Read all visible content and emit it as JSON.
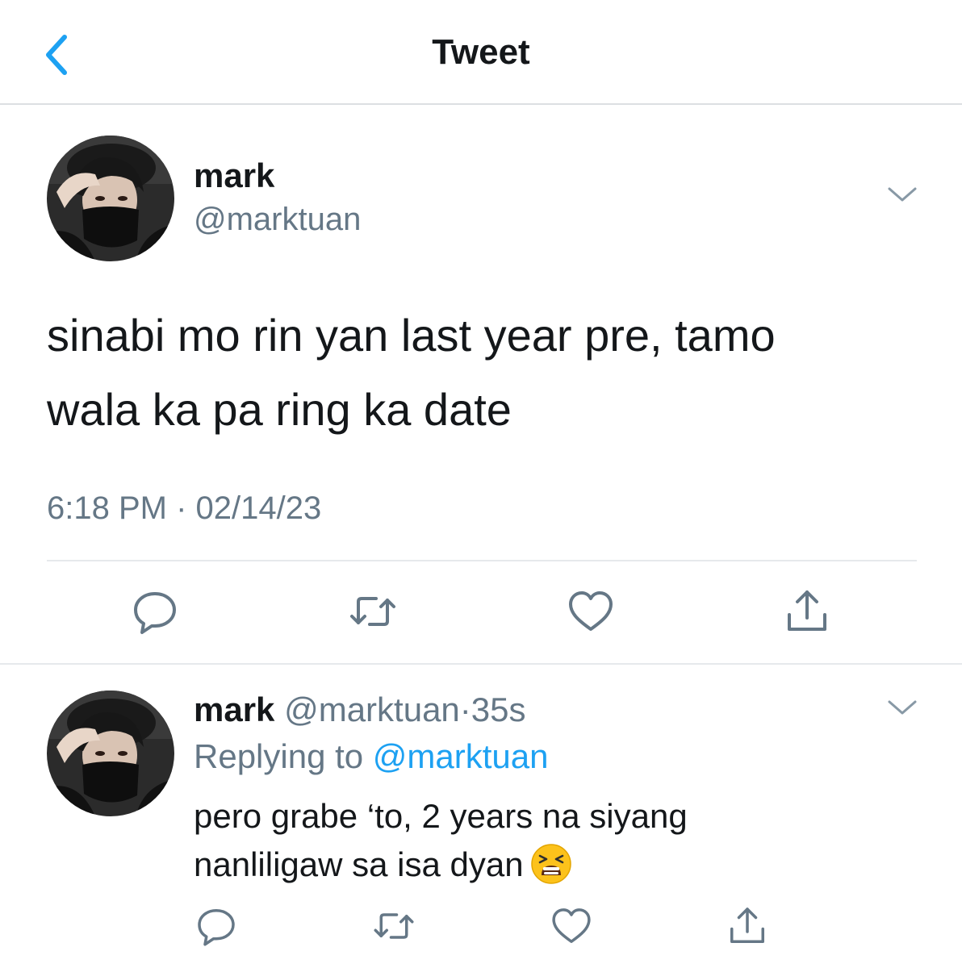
{
  "header": {
    "title": "Tweet",
    "back_icon": "chevron-left-icon",
    "accent": "#1da1f2"
  },
  "tweet": {
    "name": "mark",
    "handle": "@marktuan",
    "text_line1": "sinabi mo rin yan last year pre, tamo",
    "text_line2": "wala ka pa ring ka date",
    "timestamp": "6:18 PM · 02/14/23",
    "actions": [
      "reply-icon",
      "retweet-icon",
      "like-icon",
      "share-icon"
    ]
  },
  "reply": {
    "name": "mark",
    "handle": "@marktuan",
    "dot": "·",
    "time": "35s",
    "replying_prefix": "Replying to ",
    "replying_to": "@marktuan",
    "text_line1": "pero grabe ‘to, 2 years na siyang",
    "text_line2": "nanliligaw sa isa dyan",
    "emoji": "tired-face-emoji",
    "actions": [
      "reply-icon",
      "retweet-icon",
      "like-icon",
      "share-icon"
    ]
  },
  "colors": {
    "text": "#14171a",
    "secondary": "#657786",
    "link": "#1da1f2",
    "divider": "#e6e9ec"
  }
}
